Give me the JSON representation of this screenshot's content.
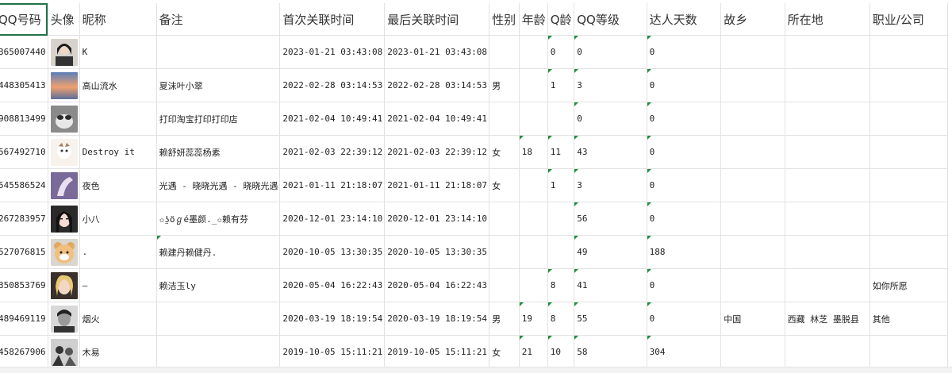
{
  "headers": {
    "qq": "QQ号码",
    "avatar": "头像",
    "nickname": "昵称",
    "note": "备注",
    "first": "首次关联时间",
    "last": "最后关联时间",
    "gender": "性别",
    "age": "年龄",
    "qage": "Q龄",
    "level": "QQ等级",
    "talent": "达人天数",
    "hometown": "故乡",
    "location": "所在地",
    "job": "职业/公司"
  },
  "rows": [
    {
      "qq": "365007440",
      "avatar": "portrait-dark-hair",
      "nickname": "K",
      "note": "",
      "first": "2023-01-21 03:43:08",
      "last": "2023-01-21 03:43:08",
      "gender": "",
      "age": "",
      "qage": "0",
      "level": "0",
      "talent": "0",
      "hometown": "",
      "location": "",
      "job": ""
    },
    {
      "qq": "448305413",
      "avatar": "sunset-sky",
      "nickname": "高山流水",
      "note": "夏沫叶小翠",
      "first": "2022-02-28 03:14:53",
      "last": "2022-02-28 03:14:53",
      "gender": "男",
      "age": "",
      "qage": "1",
      "level": "3",
      "talent": "0",
      "hometown": "",
      "location": "",
      "job": ""
    },
    {
      "qq": "908813499",
      "avatar": "cat-grey",
      "nickname": "",
      "note": "打印淘宝打印打印店",
      "first": "2021-02-04 10:49:41",
      "last": "2021-02-04 10:49:41",
      "gender": "",
      "age": "",
      "qage": "",
      "level": "0",
      "talent": "0",
      "hometown": "",
      "location": "",
      "job": ""
    },
    {
      "qq": "567492710",
      "avatar": "anime-white",
      "nickname": "Destroy it",
      "note": "赖舒妍蕊蕊杨素",
      "first": "2021-02-03 22:39:12",
      "last": "2021-02-03 22:39:12",
      "gender": "女",
      "age": "18",
      "qage": "11",
      "level": "43",
      "talent": "0",
      "hometown": "",
      "location": "",
      "job": ""
    },
    {
      "qq": "545586524",
      "avatar": "purple-hand",
      "nickname": "夜色",
      "note": "光遇 - 晓晓光遇 - 晓晓光遇",
      "first": "2021-01-11 21:18:07",
      "last": "2021-01-11 21:18:07",
      "gender": "女",
      "age": "",
      "qage": "1",
      "level": "3",
      "talent": "0",
      "hometown": "",
      "location": "",
      "job": ""
    },
    {
      "qq": "267283957",
      "avatar": "girl-dark",
      "nickname": "小八",
      "note": "✩ʖ̤öℊé墨颜._✩赖有芬",
      "first": "2020-12-01 23:14:10",
      "last": "2020-12-01 23:14:10",
      "gender": "",
      "age": "",
      "qage": "",
      "level": "56",
      "talent": "0",
      "hometown": "",
      "location": "",
      "job": ""
    },
    {
      "qq": "527076815",
      "avatar": "bear-plush",
      "nickname": ".",
      "note": "赖建丹赖健丹.",
      "first": "2020-10-05 13:30:35",
      "last": "2020-10-05 13:30:35",
      "gender": "",
      "age": "",
      "qage": "",
      "level": "49",
      "talent": "188",
      "hometown": "",
      "location": "",
      "job": ""
    },
    {
      "qq": "350853769",
      "avatar": "blonde-girl",
      "nickname": "—",
      "note": "赖洁玉ly",
      "first": "2020-05-04 16:22:43",
      "last": "2020-05-04 16:22:43",
      "gender": "",
      "age": "",
      "qage": "8",
      "level": "41",
      "talent": "0",
      "hometown": "",
      "location": "",
      "job": "如你所愿"
    },
    {
      "qq": "489469119",
      "avatar": "man-bw",
      "nickname": "烟火",
      "note": "",
      "first": "2020-03-19 18:19:54",
      "last": "2020-03-19 18:19:54",
      "gender": "男",
      "age": "19",
      "qage": "8",
      "level": "55",
      "talent": "0",
      "hometown": "中国",
      "location": "西藏 林芝 墨脱县",
      "job": "其他"
    },
    {
      "qq": "458267906",
      "avatar": "couple-bw",
      "nickname": "木易",
      "note": "",
      "first": "2019-10-05 15:11:21",
      "last": "2019-10-05 15:11:21",
      "gender": "女",
      "age": "21",
      "qage": "10",
      "level": "58",
      "talent": "304",
      "hometown": "",
      "location": "",
      "job": ""
    }
  ],
  "colors": {
    "grid_line": "#e2e2e2",
    "selection": "#217346",
    "comment_marker": "#1e8e3e"
  }
}
